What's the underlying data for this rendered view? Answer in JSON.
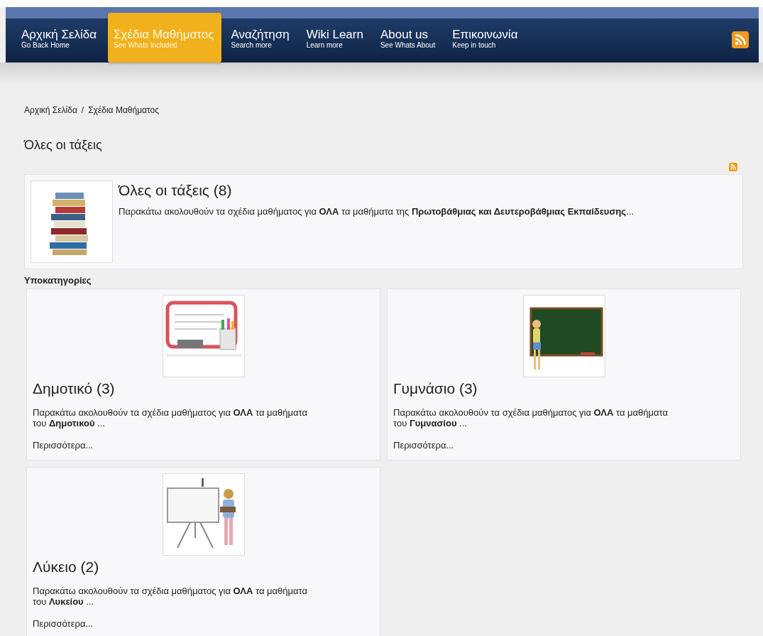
{
  "nav": {
    "items": [
      {
        "title": "Αρχική Σελίδα",
        "subtitle": "Go Back Home",
        "selected": false
      },
      {
        "title": "Σχέδια Μαθήματος",
        "subtitle": "See Whats Included",
        "selected": true
      },
      {
        "title": "Αναζήτηση",
        "subtitle": "Search more",
        "selected": false
      },
      {
        "title": "Wiki Learn",
        "subtitle": "Learn more",
        "selected": false
      },
      {
        "title": "About us",
        "subtitle": "See Whats About",
        "selected": false
      },
      {
        "title": "Επικοινωνία",
        "subtitle": "Keep in touch",
        "selected": false
      }
    ]
  },
  "breadcrumb": {
    "items": [
      "Αρχική Σελίδα",
      "Σχέδια Μαθήματος"
    ],
    "separator": "/"
  },
  "page_title": "Όλες οι τάξεις",
  "category": {
    "title": "Όλες οι τάξεις (8)",
    "description": "Παρακάτω ακολουθούν τα σχέδια μαθήματος για **ΟΛΑ** τα μαθήματα της **Πρωτοβάθμιας και Δευτεροβάθμιας Εκπαίδευσης**..."
  },
  "subcategories_heading": "Υποκατηγορίες",
  "subcategories": [
    {
      "title": "Δημοτικό (3)",
      "description": "Παρακάτω ακολουθούν τα σχέδια μαθήματος για **ΟΛΑ** τα μαθήματα του **Δημοτικού** ...",
      "more_link": "Περισσότερα..."
    },
    {
      "title": "Γυμνάσιο (3)",
      "description": "Παρακάτω ακολουθούν τα σχέδια μαθήματος για **ΟΛΑ** τα μαθήματα του **Γυμνασίου** ...",
      "more_link": "Περισσότερα..."
    },
    {
      "title": "Λύκειο (2)",
      "description": "Παρακάτω ακολουθούν τα σχέδια μαθήματος για **ΟΛΑ** τα μαθήματα του **Λυκείου** ...",
      "more_link": "Περισσότερα..."
    }
  ]
}
